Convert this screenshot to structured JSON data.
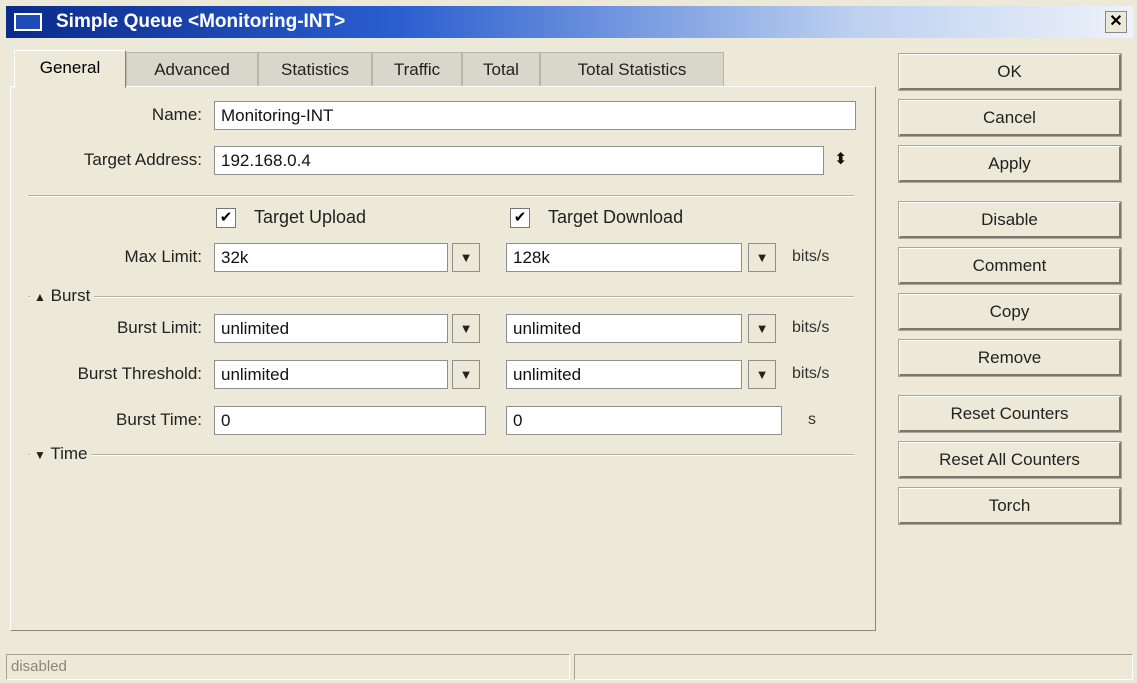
{
  "window": {
    "title": "Simple Queue <Monitoring-INT>",
    "close": "✕"
  },
  "tabs": [
    "General",
    "Advanced",
    "Statistics",
    "Traffic",
    "Total",
    "Total Statistics"
  ],
  "general": {
    "name_label": "Name:",
    "name_value": "Monitoring-INT",
    "target_address_label": "Target Address:",
    "target_address_value": "192.168.0.4",
    "target_upload_label": "Target Upload",
    "target_upload_checked": true,
    "target_download_label": "Target Download",
    "target_download_checked": true,
    "max_limit_label": "Max Limit:",
    "max_limit_upload": "32k",
    "max_limit_download": "128k",
    "unit_bits": "bits/s",
    "burst_section": "Burst",
    "burst_limit_label": "Burst Limit:",
    "burst_limit_upload": "unlimited",
    "burst_limit_download": "unlimited",
    "burst_threshold_label": "Burst Threshold:",
    "burst_threshold_upload": "unlimited",
    "burst_threshold_download": "unlimited",
    "burst_time_label": "Burst Time:",
    "burst_time_upload": "0",
    "burst_time_download": "0",
    "unit_seconds": "s",
    "time_section": "Time"
  },
  "buttons": {
    "ok": "OK",
    "cancel": "Cancel",
    "apply": "Apply",
    "disable": "Disable",
    "comment": "Comment",
    "copy": "Copy",
    "remove": "Remove",
    "reset_counters": "Reset Counters",
    "reset_all_counters": "Reset All Counters",
    "torch": "Torch"
  },
  "status": {
    "state": "disabled"
  },
  "glyphs": {
    "check": "✔",
    "spin": "▼",
    "updown": "⬍",
    "section_open": "▲",
    "section_closed": "▼"
  }
}
